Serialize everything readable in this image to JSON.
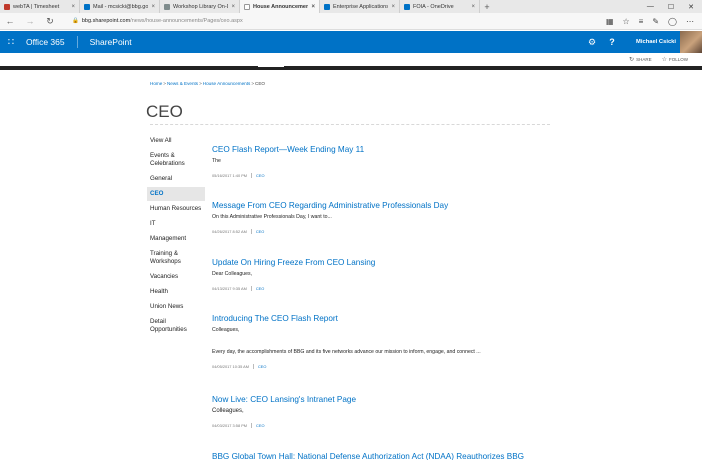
{
  "browser": {
    "tabs": [
      {
        "title": "webTA | Timesheet",
        "color": "#c0392b",
        "active": false
      },
      {
        "title": "Mail - mcsicki@bbg.gov",
        "color": "#0072c6",
        "active": false
      },
      {
        "title": "Workshop Library On-Demo",
        "color": "#7f8c8d",
        "active": false
      },
      {
        "title": "House Announcements",
        "color": "#ffffff",
        "active": true
      },
      {
        "title": "Enterprise Applications Lim",
        "color": "#0072c6",
        "active": false
      },
      {
        "title": "FOIA - OneDrive",
        "color": "#0072c6",
        "active": false
      }
    ],
    "new_tab": "+",
    "close_glyph": "×",
    "window_controls": [
      "—",
      "☐",
      "✕"
    ],
    "url_host": "bbg.sharepoint.com",
    "url_path": "/news/house-announcements/Pages/ceo.aspx"
  },
  "suite": {
    "brand": "Office 365",
    "app": "SharePoint",
    "user": "Michael Csicki"
  },
  "page_actions": {
    "share": "SHARE",
    "follow": "FOLLOW"
  },
  "breadcrumb": [
    "Home",
    "News & Events",
    "House Announcements",
    "CEO"
  ],
  "page_title": "CEO",
  "leftnav": [
    {
      "label": "View All",
      "selected": false
    },
    {
      "label": "Events & Celebrations",
      "selected": false
    },
    {
      "label": "General",
      "selected": false
    },
    {
      "label": "CEO",
      "selected": true
    },
    {
      "label": "Human Resources",
      "selected": false
    },
    {
      "label": "IT",
      "selected": false
    },
    {
      "label": "Management",
      "selected": false
    },
    {
      "label": "Training & Workshops",
      "selected": false
    },
    {
      "label": "Vacancies",
      "selected": false
    },
    {
      "label": "Health",
      "selected": false
    },
    {
      "label": "Union News",
      "selected": false
    },
    {
      "label": "Detail Opportunities",
      "selected": false
    }
  ],
  "posts": [
    {
      "title": "CEO Flash Report—Week Ending May 11",
      "excerpt": "The",
      "excerpt2": "",
      "date": "05/16/2017 1:40 PM",
      "category": "CEO"
    },
    {
      "title": "Message From CEO Regarding Administrative Professionals Day",
      "excerpt": "On this Administrative Professionals Day, I want to...",
      "excerpt2": "",
      "date": "04/26/2017 8:52 AM",
      "category": "CEO"
    },
    {
      "title": "Update On Hiring Freeze From CEO Lansing",
      "excerpt": "Dear Colleagues,",
      "excerpt2": "",
      "date": "04/13/2017 9:35 AM",
      "category": "CEO"
    },
    {
      "title": "Introducing The CEO Flash Report",
      "excerpt": "Colleagues,",
      "excerpt2": "Every day, the accomplishments of BBG and its five networks advance our mission to inform, engage, and connect ...",
      "date": "04/05/2017 10:35 AM",
      "category": "CEO"
    },
    {
      "title": "Now Live: CEO Lansing's Intranet Page",
      "excerpt": "Colleagues,",
      "excerpt2": "",
      "date": "04/03/2017 3:58 PM",
      "category": "CEO"
    },
    {
      "title": "BBG Global Town Hall: National Defense Authorization Act (NDAA) Reauthorizes BBG",
      "excerpt": "",
      "excerpt2": "",
      "date": "",
      "category": ""
    }
  ]
}
